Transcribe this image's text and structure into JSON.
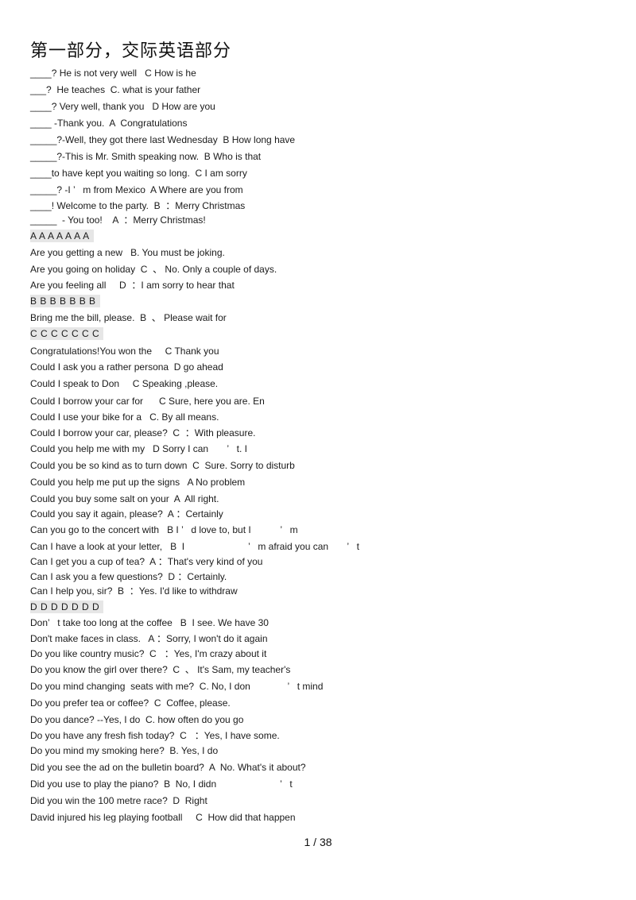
{
  "title": "第一部分，交际英语部分",
  "lines": [
    {
      "text": "____? He is not very well   C How is he",
      "highlight": false
    },
    {
      "text": "___?  He teaches  C. what is your father",
      "highlight": false
    },
    {
      "text": "____? Very well, thank you   D How are you",
      "highlight": false
    },
    {
      "text": "____ -Thank you.  A  Congratulations",
      "highlight": false
    },
    {
      "text": "_____?-Well, they got there last Wednesday  B How long have",
      "highlight": false
    },
    {
      "text": "_____?-This is Mr. Smith speaking now.  B Who is that",
      "highlight": false
    },
    {
      "text": "____to have kept you waiting so long.  C I am sorry",
      "highlight": false
    },
    {
      "text": "_____? -I ’   m from Mexico  A Where are you from",
      "highlight": false
    },
    {
      "text": "____! Welcome to the party.  B  ：Merry Christmas",
      "highlight": false
    },
    {
      "text": "_____  - You too!    A  ：Merry Christmas!",
      "highlight": false
    },
    {
      "text": "A A A A A A A",
      "highlight": true
    },
    {
      "text": "Are you getting a new   B. You must be joking.",
      "highlight": false
    },
    {
      "text": "Are you going on holiday  C  、 No. Only a couple of days.",
      "highlight": false
    },
    {
      "text": "Are you feeling all     D  ：I am sorry to hear that",
      "highlight": false
    },
    {
      "text": "B B B B B B B",
      "highlight": true
    },
    {
      "text": "Bring me the bill, please.  B  、 Please wait for",
      "highlight": false
    },
    {
      "text": "C C C C C C C",
      "highlight": true
    },
    {
      "text": "Congratulations!You won the     C Thank you",
      "highlight": false
    },
    {
      "text": "Could I ask you a rather persona  D go ahead",
      "highlight": false
    },
    {
      "text": "Could I speak to Don     C Speaking ,please.",
      "highlight": false
    },
    {
      "text": "Could I borrow your car for      C Sure, here you are. En",
      "highlight": false
    },
    {
      "text": "Could I use your bike for a   C. By all means.",
      "highlight": false
    },
    {
      "text": "Could I borrow your car, please?  C  ：With pleasure.",
      "highlight": false
    },
    {
      "text": "Could you help me with my   D Sorry I can       ’   t. I",
      "highlight": false
    },
    {
      "text": "Could you be so kind as to turn down  C  Sure. Sorry to disturb",
      "highlight": false
    },
    {
      "text": "Could you help me put up the signs   A No problem",
      "highlight": false
    },
    {
      "text": "Could you buy some salt on your  A  All right.",
      "highlight": false
    },
    {
      "text": "Could you say it again, please?  A ：Certainly",
      "highlight": false
    },
    {
      "text": "Can you go to the concert with   B I ’   d love to, but I           ’   m",
      "highlight": false
    },
    {
      "text": "Can I have a look at your letter,   B  I                        ’   m afraid you can       ’   t",
      "highlight": false
    },
    {
      "text": "Can I get you a cup of tea?  A ：That's very kind of you",
      "highlight": false
    },
    {
      "text": "Can I ask you a few questions?  D ：Certainly.",
      "highlight": false
    },
    {
      "text": "Can I help you, sir?  B  ：Yes. I'd like to withdraw",
      "highlight": false
    },
    {
      "text": "D D D D D D D",
      "highlight": true
    },
    {
      "text": "Don’   t take too long at the coffee   B  I see. We have 30",
      "highlight": false
    },
    {
      "text": "Don't make faces in class.   A ：Sorry, I won't do it again",
      "highlight": false
    },
    {
      "text": "Do you like country music?  C   ：Yes, I'm crazy about it",
      "highlight": false
    },
    {
      "text": "Do you know the girl over there?  C  、 It's Sam, my teacher's",
      "highlight": false
    },
    {
      "text": "Do you mind changing  seats with me?  C. No, I don              ’   t mind",
      "highlight": false
    },
    {
      "text": "Do you prefer tea or coffee?  C  Coffee, please.",
      "highlight": false
    },
    {
      "text": "Do you dance? --Yes, I do  C. how often do you go",
      "highlight": false
    },
    {
      "text": "Do you have any fresh fish today?  C   ：Yes, I have some.",
      "highlight": false
    },
    {
      "text": "Do you mind my smoking here?  B. Yes, I do",
      "highlight": false
    },
    {
      "text": "Did you see the ad on the bulletin board?  A  No. What's it about?",
      "highlight": false
    },
    {
      "text": "Did you use to play the piano?  B  No, I didn                        ’   t",
      "highlight": false
    },
    {
      "text": "Did you win the 100 metre race?  D  Right",
      "highlight": false
    },
    {
      "text": "David injured his leg playing football     C  How did that happen",
      "highlight": false
    }
  ],
  "footer": {
    "page_indicator": "1 / 38"
  }
}
